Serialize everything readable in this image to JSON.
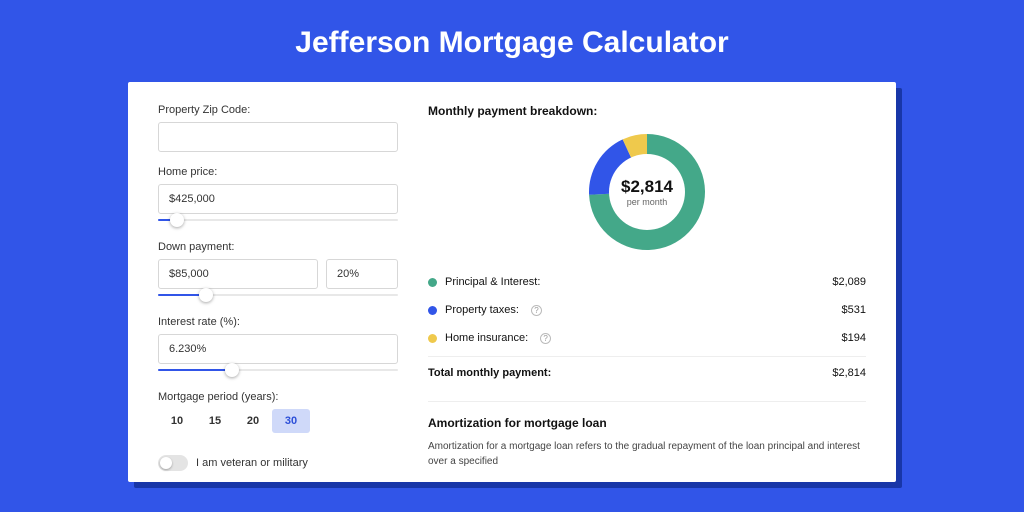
{
  "title": "Jefferson Mortgage Calculator",
  "form": {
    "zip_label": "Property Zip Code:",
    "zip_value": "",
    "home_price_label": "Home price:",
    "home_price_value": "$425,000",
    "home_price_slider_pct": 8,
    "down_payment_label": "Down payment:",
    "down_payment_value": "$85,000",
    "down_payment_pct_value": "20%",
    "down_payment_slider_pct": 20,
    "interest_rate_label": "Interest rate (%):",
    "interest_rate_value": "6.230%",
    "interest_rate_slider_pct": 31,
    "mortgage_period_label": "Mortgage period (years):",
    "period_options": [
      "10",
      "15",
      "20",
      "30"
    ],
    "period_active": "30",
    "veteran_checked": false,
    "veteran_label": "I am veteran or military"
  },
  "breakdown": {
    "title": "Monthly payment breakdown:",
    "center_amount": "$2,814",
    "center_sub": "per month",
    "items": [
      {
        "label": "Principal & Interest:",
        "value": "$2,089",
        "hint": false
      },
      {
        "label": "Property taxes:",
        "value": "$531",
        "hint": true
      },
      {
        "label": "Home insurance:",
        "value": "$194",
        "hint": true
      }
    ],
    "total_label": "Total monthly payment:",
    "total_value": "$2,814"
  },
  "amortization": {
    "title": "Amortization for mortgage loan",
    "body": "Amortization for a mortgage loan refers to the gradual repayment of the loan principal and interest over a specified"
  },
  "chart_data": {
    "type": "pie",
    "title": "Monthly payment breakdown",
    "series": [
      {
        "name": "Principal & Interest",
        "value": 2089,
        "color": "#44a889"
      },
      {
        "name": "Property taxes",
        "value": 531,
        "color": "#3155e8"
      },
      {
        "name": "Home insurance",
        "value": 194,
        "color": "#efc94c"
      }
    ],
    "total": 2814,
    "unit": "$ per month"
  },
  "colors": {
    "accent": "#3155e8",
    "green": "#44a889",
    "yellow": "#efc94c"
  }
}
